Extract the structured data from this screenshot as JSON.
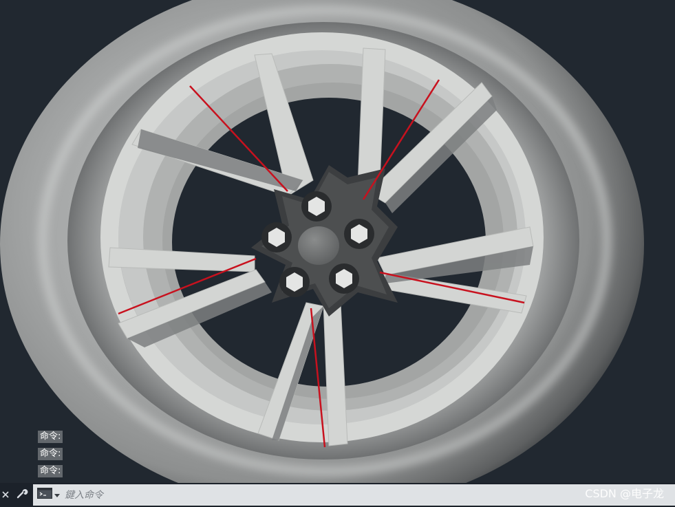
{
  "command_history": [
    "命令:",
    "命令:",
    "命令:"
  ],
  "command_line": {
    "placeholder": "鍵入命令"
  },
  "watermark": "CSDN @电子龙",
  "colors": {
    "background": "#212830",
    "rim_face": "#d5d7d5",
    "hub": "#4d4f50",
    "tire": "#8b8d8d",
    "accent_line": "#c8111e",
    "command_bar": "#1c222a",
    "input_bg": "#dfe2e5"
  },
  "icons": [
    "close-icon",
    "wrench-icon",
    "command-prompt-icon",
    "dropdown-arrow-icon"
  ]
}
